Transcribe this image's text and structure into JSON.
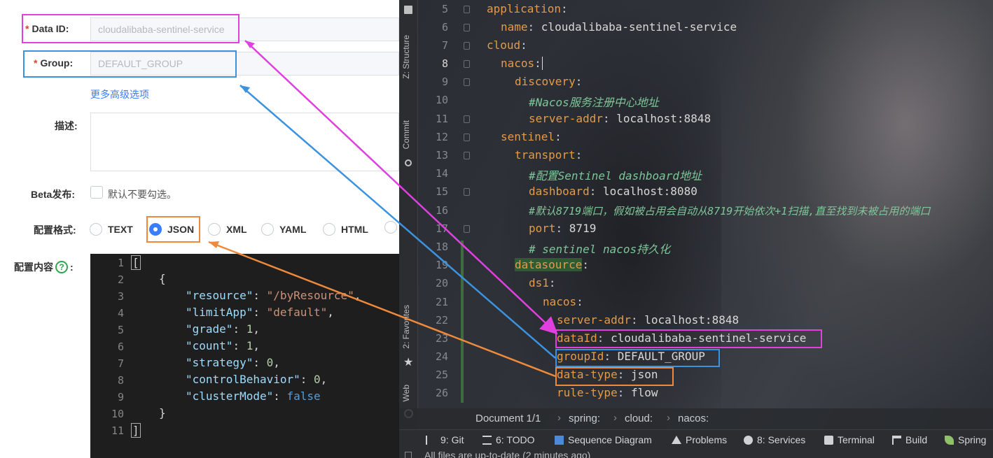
{
  "form": {
    "data_id_label": "Data ID:",
    "data_id_value": "cloudalibaba-sentinel-service",
    "group_label": "Group:",
    "group_value": "DEFAULT_GROUP",
    "required_mark": "*",
    "advanced_link": "更多高级选项",
    "desc_label": "描述:",
    "beta_label": "Beta发布:",
    "beta_text": "默认不要勾选。",
    "format_label": "配置格式:",
    "formats": [
      "TEXT",
      "JSON",
      "XML",
      "YAML",
      "HTML"
    ],
    "selected_format": "JSON",
    "content_label": "配置内容",
    "content_colon": ":",
    "help_icon": "?",
    "editor_lines": [
      "1",
      "2",
      "3",
      "4",
      "5",
      "6",
      "7",
      "8",
      "9",
      "10",
      "11"
    ],
    "json": {
      "open_bracket": "[",
      "open_brace": "{",
      "k1": "\"resource\"",
      "v1": "\"/byResource\"",
      "k2": "\"limitApp\"",
      "v2": "\"default\"",
      "k3": "\"grade\"",
      "v3": "1",
      "k4": "\"count\"",
      "v4": "1",
      "k5": "\"strategy\"",
      "v5": "0",
      "k6": "\"controlBehavior\"",
      "v6": "0",
      "k7": "\"clusterMode\"",
      "v7": "false",
      "close_brace": "}",
      "close_bracket": "]"
    }
  },
  "ide": {
    "side_tabs": [
      "Z: Structure",
      "Commit",
      "2: Favorites",
      "Web"
    ],
    "line_numbers": [
      "5",
      "6",
      "7",
      "8",
      "9",
      "10",
      "11",
      "12",
      "13",
      "14",
      "15",
      "16",
      "17",
      "18",
      "19",
      "20",
      "21",
      "22",
      "23",
      "24",
      "25",
      "26"
    ],
    "yaml": [
      {
        "key": "application",
        "sep": ":",
        "val": ""
      },
      {
        "key": "name",
        "sep": ": ",
        "val": "cloudalibaba-sentinel-service"
      },
      {
        "key": "cloud",
        "sep": ":",
        "val": ""
      },
      {
        "key": "nacos",
        "sep": ":",
        "val": ""
      },
      {
        "key": "discovery",
        "sep": ":",
        "val": ""
      },
      {
        "comment": "#Nacos服务注册中心地址"
      },
      {
        "key": "server-addr",
        "sep": ": ",
        "val": "localhost:8848"
      },
      {
        "key": "sentinel",
        "sep": ":",
        "val": ""
      },
      {
        "key": "transport",
        "sep": ":",
        "val": ""
      },
      {
        "comment": "#配置Sentinel dashboard地址"
      },
      {
        "key": "dashboard",
        "sep": ": ",
        "val": "localhost:8080"
      },
      {
        "comment": "#默认8719端口，假如被占用会自动从8719开始依次+1扫描,直至找到未被占用的端口"
      },
      {
        "key": "port",
        "sep": ": ",
        "val": "8719"
      },
      {
        "comment": "# sentinel nacos持久化"
      },
      {
        "key": "datasource",
        "sep": ":",
        "val": ""
      },
      {
        "key": "ds1",
        "sep": ":",
        "val": ""
      },
      {
        "key": "nacos",
        "sep": ":",
        "val": ""
      },
      {
        "key": "server-addr",
        "sep": ": ",
        "val": "localhost:8848"
      },
      {
        "key": "dataId",
        "sep": ": ",
        "val": "cloudalibaba-sentinel-service"
      },
      {
        "key": "groupId",
        "sep": ": ",
        "val": "DEFAULT_GROUP"
      },
      {
        "key": "data-type",
        "sep": ": ",
        "val": "json"
      },
      {
        "key": "rule-type",
        "sep": ": ",
        "val": "flow"
      }
    ],
    "breadcrumb": [
      "Document 1/1",
      "spring:",
      "cloud:",
      "nacos:"
    ],
    "breadcrumb_sep": "›",
    "toolwindows": [
      {
        "label": "9: Git",
        "icon": "git-branch-icon"
      },
      {
        "label": "6: TODO",
        "icon": "list-icon"
      },
      {
        "label": "Sequence Diagram",
        "icon": "sequence-diagram-icon"
      },
      {
        "label": "Problems",
        "icon": "warning-icon"
      },
      {
        "label": "8: Services",
        "icon": "services-icon"
      },
      {
        "label": "Terminal",
        "icon": "terminal-icon"
      },
      {
        "label": "Build",
        "icon": "hammer-icon"
      },
      {
        "label": "Spring",
        "icon": "leaf-icon"
      }
    ],
    "status_text": "All files are up-to-date (2 minutes ago)"
  },
  "colors": {
    "magenta": "#e040e0",
    "blue": "#3b93e0",
    "orange": "#ef8a3c",
    "accent": "#3a7dff"
  }
}
